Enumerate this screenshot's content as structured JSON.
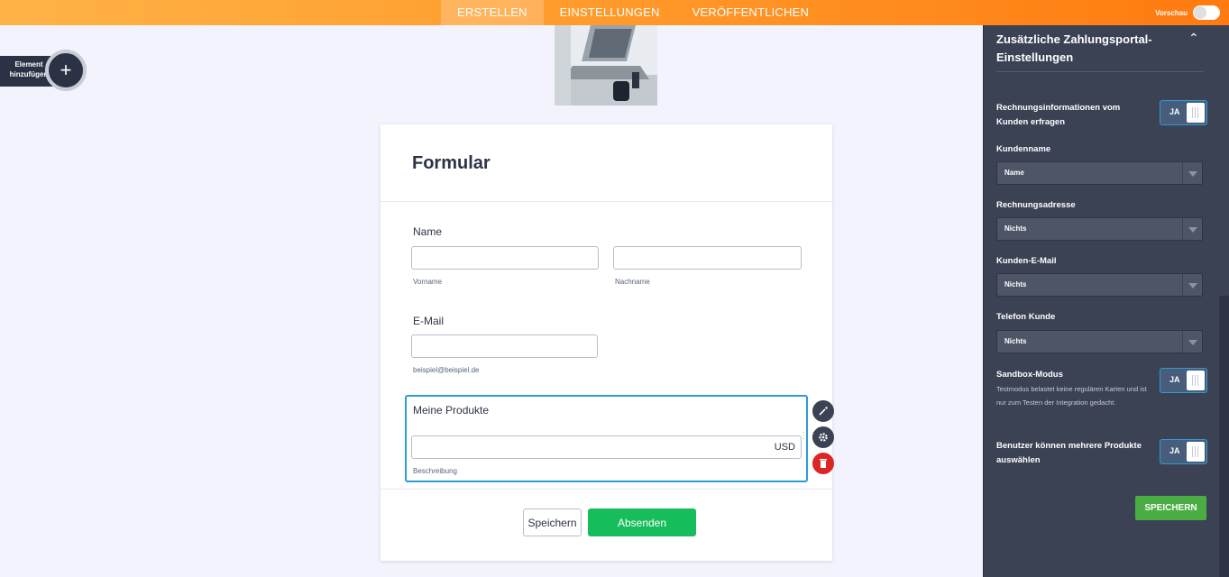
{
  "topbar": {
    "tabs": [
      {
        "label": "ERSTELLEN"
      },
      {
        "label": "EINSTELLUNGEN"
      },
      {
        "label": "VERÖFFENTLICHEN"
      }
    ],
    "preview_label": "Vorschau"
  },
  "add_element": {
    "label": "Element hinzufügen"
  },
  "form": {
    "title": "Formular",
    "name_label": "Name",
    "first_name_sublabel": "Vorname",
    "last_name_sublabel": "Nachname",
    "email_label": "E-Mail",
    "email_sublabel": "beispiel@beispiel.de",
    "products_label": "Meine Produkte",
    "currency": "USD",
    "description_sublabel": "Beschreibung",
    "save_button": "Speichern",
    "submit_button": "Absenden"
  },
  "panel": {
    "title": "Zusätzliche Zahlungsportal-Einstellungen",
    "billing_info_label": "Rechnungsinformationen vom Kunden erfragen",
    "billing_info_toggle": "JA",
    "customer_name_label": "Kundenname",
    "customer_name_value": "Name",
    "billing_address_label": "Rechnungsadresse",
    "billing_address_value": "Nichts",
    "customer_email_label": "Kunden-E-Mail",
    "customer_email_value": "Nichts",
    "phone_label": "Telefon Kunde",
    "phone_value": "Nichts",
    "sandbox_label": "Sandbox-Modus",
    "sandbox_desc": "Testmodus belastet keine regulären Karten und ist nur zum Testen der Integration gedacht.",
    "sandbox_toggle": "JA",
    "multi_products_label": "Benutzer können mehrere Produkte auswählen",
    "multi_products_toggle": "JA",
    "save_button": "SPEICHERN"
  },
  "colors": {
    "topbar_start": "#ffb347",
    "topbar_end": "#ff7a10",
    "panel_bg": "#3b4254",
    "submit_green": "#18bd5b",
    "panel_save_green": "#4aad43",
    "selection_blue": "#2e9bd6",
    "delete_red": "#dc2626"
  }
}
